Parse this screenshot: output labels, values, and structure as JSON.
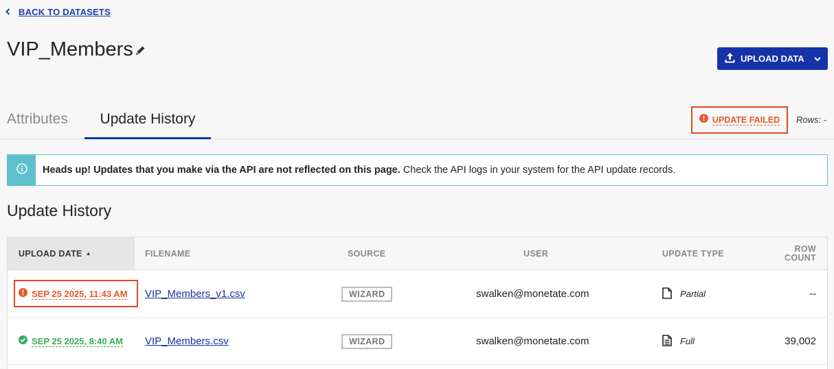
{
  "nav": {
    "back_label": "BACK TO DATASETS"
  },
  "header": {
    "title": "VIP_Members",
    "upload_label": "UPLOAD DATA"
  },
  "tabs": [
    {
      "label": "Attributes",
      "active": false
    },
    {
      "label": "Update History",
      "active": true
    }
  ],
  "status": {
    "label": "UPDATE FAILED",
    "rows_label": "Rows: -"
  },
  "banner": {
    "bold_text": "Heads up! Updates that you make via the API are not reflected on this page.",
    "text": " Check the API logs in your system for the API update records."
  },
  "section": {
    "title": "Update History"
  },
  "table": {
    "columns": {
      "upload_date": "UPLOAD DATE",
      "filename": "FILENAME",
      "source": "SOURCE",
      "user": "USER",
      "update_type": "UPDATE TYPE",
      "row_count_1": "ROW",
      "row_count_2": "COUNT"
    },
    "rows": [
      {
        "status": "failed",
        "upload_date": "SEP 25 2025, 11:43 AM",
        "filename": "VIP_Members_v1.csv",
        "source": "WIZARD",
        "user": "swalken@monetate.com",
        "update_type": "Partial",
        "row_count": "--"
      },
      {
        "status": "success",
        "upload_date": "SEP 25 2025, 8:40 AM",
        "filename": "VIP_Members.csv",
        "source": "WIZARD",
        "user": "swalken@monetate.com",
        "update_type": "Full",
        "row_count": "39,002"
      }
    ]
  },
  "colors": {
    "accent": "#1532a8",
    "error": "#e55a2b",
    "success": "#3bab5a",
    "info": "#5ec0cc"
  },
  "icons": [
    "chevron-left-icon",
    "pencil-icon",
    "upload-icon",
    "chevron-down-icon",
    "error-circle-icon",
    "info-circle-icon",
    "sort-up-icon",
    "document-partial-icon",
    "check-circle-icon",
    "document-full-icon"
  ]
}
